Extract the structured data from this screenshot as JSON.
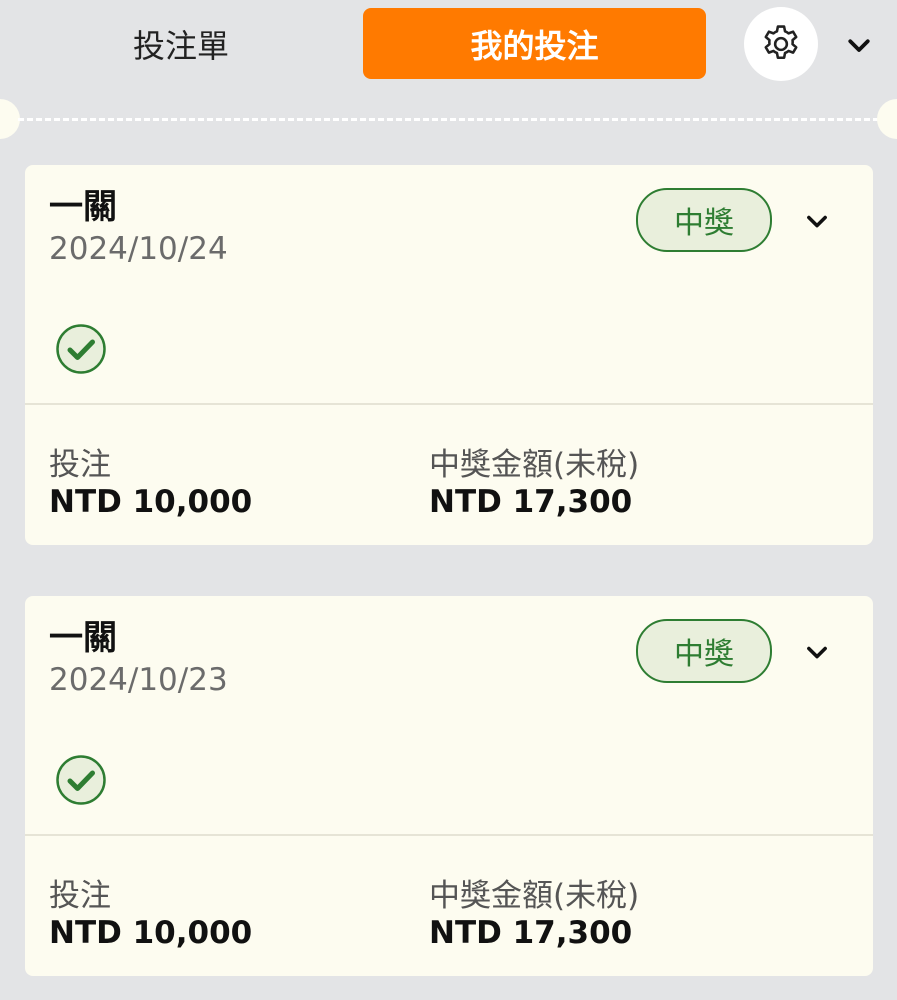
{
  "tabs": {
    "betslip_label": "投注單",
    "mybets_label": "我的投注"
  },
  "icons": {
    "settings": "gear-icon",
    "collapse": "chevron-down-icon",
    "expand": "chevron-down-icon",
    "status_check": "check-circle-icon"
  },
  "colors": {
    "accent": "#ff7a00",
    "win_green": "#2e7d32",
    "card_bg": "#fdfcf0",
    "page_bg": "#e3e4e6"
  },
  "bets": [
    {
      "title": "一關",
      "date": "2024/10/24",
      "status": "中獎",
      "stake_label": "投注",
      "stake_value": "NTD 10,000",
      "payout_label": "中獎金額(未稅)",
      "payout_value": "NTD 17,300"
    },
    {
      "title": "一關",
      "date": "2024/10/23",
      "status": "中獎",
      "stake_label": "投注",
      "stake_value": "NTD 10,000",
      "payout_label": "中獎金額(未稅)",
      "payout_value": "NTD 17,300"
    }
  ]
}
